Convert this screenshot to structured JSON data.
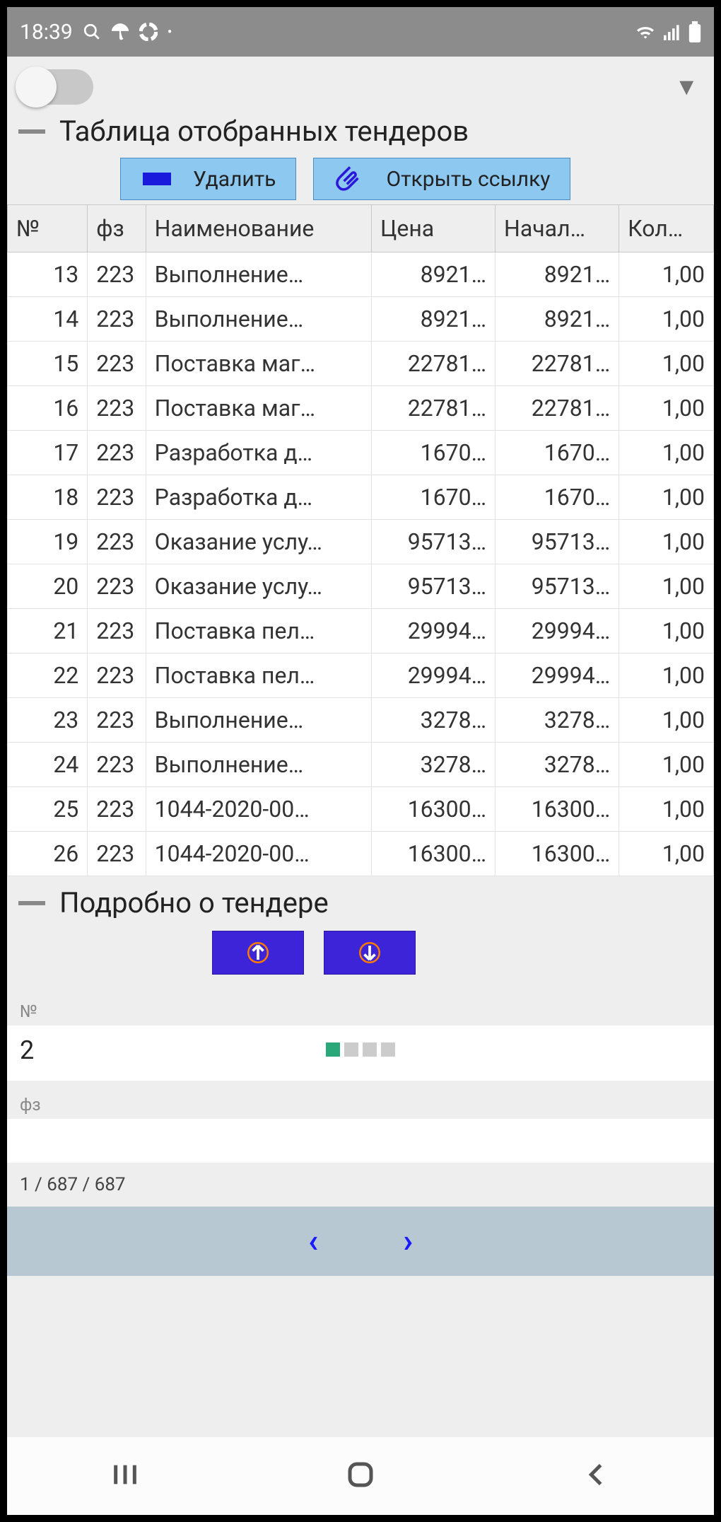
{
  "statusbar": {
    "time": "18:39"
  },
  "sections": {
    "table_title": "Таблица отобранных тендеров",
    "details_title": "Подробно о тендере"
  },
  "buttons": {
    "delete": "Удалить",
    "open_link": "Открыть  ссылку"
  },
  "table": {
    "headers": {
      "no": "№",
      "fz": "фз",
      "name": "Наименование",
      "price": "Цена",
      "start": "Начал…",
      "qty": "Кол…"
    },
    "rows": [
      {
        "no": "13",
        "fz": "223",
        "name": "Выполнение…",
        "price": "8921…",
        "start": "8921…",
        "qty": "1,00"
      },
      {
        "no": "14",
        "fz": "223",
        "name": "Выполнение…",
        "price": "8921…",
        "start": "8921…",
        "qty": "1,00"
      },
      {
        "no": "15",
        "fz": "223",
        "name": "Поставка маг…",
        "price": "22781…",
        "start": "22781…",
        "qty": "1,00"
      },
      {
        "no": "16",
        "fz": "223",
        "name": "Поставка маг…",
        "price": "22781…",
        "start": "22781…",
        "qty": "1,00"
      },
      {
        "no": "17",
        "fz": "223",
        "name": "Разработка д…",
        "price": "1670…",
        "start": "1670…",
        "qty": "1,00"
      },
      {
        "no": "18",
        "fz": "223",
        "name": "Разработка д…",
        "price": "1670…",
        "start": "1670…",
        "qty": "1,00"
      },
      {
        "no": "19",
        "fz": "223",
        "name": "Оказание услу…",
        "price": "95713…",
        "start": "95713…",
        "qty": "1,00"
      },
      {
        "no": "20",
        "fz": "223",
        "name": "Оказание услу…",
        "price": "95713…",
        "start": "95713…",
        "qty": "1,00"
      },
      {
        "no": "21",
        "fz": "223",
        "name": "Поставка пел…",
        "price": "29994…",
        "start": "29994…",
        "qty": "1,00"
      },
      {
        "no": "22",
        "fz": "223",
        "name": "Поставка пел…",
        "price": "29994…",
        "start": "29994…",
        "qty": "1,00"
      },
      {
        "no": "23",
        "fz": "223",
        "name": "Выполнение…",
        "price": "3278…",
        "start": "3278…",
        "qty": "1,00"
      },
      {
        "no": "24",
        "fz": "223",
        "name": "Выполнение…",
        "price": "3278…",
        "start": "3278…",
        "qty": "1,00"
      },
      {
        "no": "25",
        "fz": "223",
        "name": "1044-2020-00…",
        "price": "16300…",
        "start": "16300…",
        "qty": "1,00"
      },
      {
        "no": "26",
        "fz": "223",
        "name": "1044-2020-00…",
        "price": "16300…",
        "start": "16300…",
        "qty": "1,00"
      }
    ]
  },
  "details": {
    "no_label": "№",
    "no_value": "2",
    "fz_label": "фз"
  },
  "counter": "1 / 687 / 687"
}
